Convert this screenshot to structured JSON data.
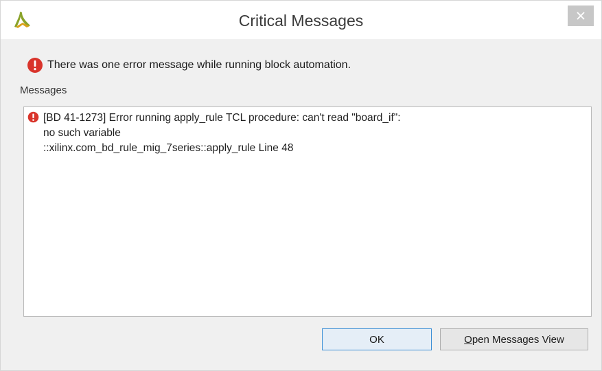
{
  "window": {
    "title": "Critical Messages",
    "app_icon": "vivado-logo-icon",
    "close_icon": "close-icon"
  },
  "summary": {
    "icon": "error-icon",
    "text": "There was one error message while running block automation."
  },
  "messages": {
    "label": "Messages",
    "items": [
      {
        "icon": "error-icon",
        "lines": [
          "[BD 41-1273] Error running apply_rule TCL procedure: can't read \"board_if\":",
          "no such variable",
          "::xilinx.com_bd_rule_mig_7series::apply_rule Line 48"
        ]
      }
    ]
  },
  "buttons": {
    "ok_label": "OK",
    "open_messages_first": "O",
    "open_messages_rest": "pen Messages View"
  },
  "colors": {
    "error_red": "#d9342b",
    "focus_blue": "#3c8fd6"
  }
}
